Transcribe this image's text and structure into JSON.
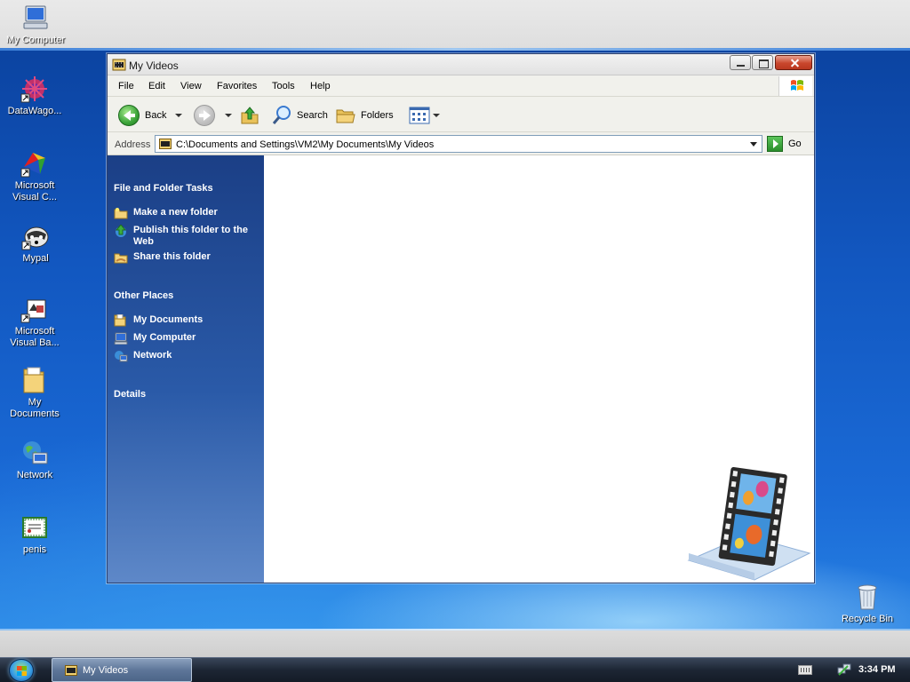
{
  "desktop": {
    "icons": [
      {
        "label": "My Computer",
        "icon": "computer-icon"
      },
      {
        "label": "DataWago...",
        "icon": "datawagon-icon"
      },
      {
        "label": "Microsoft Visual C...",
        "icon": "visual-c-icon"
      },
      {
        "label": "Mypal",
        "icon": "mypal-icon"
      },
      {
        "label": "Microsoft Visual Ba...",
        "icon": "visual-basic-icon"
      },
      {
        "label": "My Documents",
        "icon": "folder-icon"
      },
      {
        "label": "Network",
        "icon": "network-icon"
      },
      {
        "label": "penis",
        "icon": "document-icon"
      },
      {
        "label": "Recycle Bin",
        "icon": "recycle-bin-icon"
      }
    ]
  },
  "window": {
    "title": "My Videos",
    "menu": [
      "File",
      "Edit",
      "View",
      "Favorites",
      "Tools",
      "Help"
    ],
    "toolbar": {
      "back": "Back",
      "search": "Search",
      "folders": "Folders"
    },
    "address": {
      "label": "Address",
      "value": "C:\\Documents and Settings\\VM2\\My Documents\\My Videos",
      "go": "Go"
    },
    "taskpane": {
      "file_tasks_heading": "File and Folder Tasks",
      "file_tasks": [
        {
          "label": "Make a new folder",
          "icon": "new-folder-icon"
        },
        {
          "label": "Publish this folder to the Web",
          "icon": "publish-web-icon"
        },
        {
          "label": "Share this folder",
          "icon": "share-folder-icon"
        }
      ],
      "other_places_heading": "Other Places",
      "other_places": [
        {
          "label": "My Documents",
          "icon": "my-documents-icon"
        },
        {
          "label": "My Computer",
          "icon": "my-computer-icon"
        },
        {
          "label": "Network",
          "icon": "network-icon"
        }
      ],
      "details_heading": "Details"
    }
  },
  "taskbar": {
    "task_button": "My Videos",
    "clock": "3:34 PM"
  },
  "colors": {
    "taskpane_top": "#1b3f86",
    "taskpane_bottom": "#5e88c8",
    "taskbar": "#1d2634",
    "close_button": "#c9462c"
  }
}
